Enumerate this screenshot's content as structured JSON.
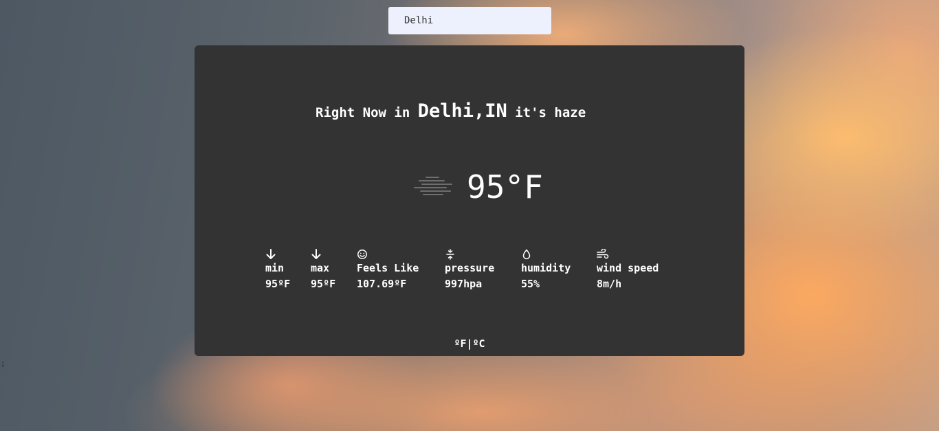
{
  "search": {
    "value": "Delhi"
  },
  "stray_text": ";",
  "weather": {
    "headline_prefix": "Right Now in ",
    "place": "Delhi,IN",
    "headline_suffix": " it's haze",
    "condition_icon": "haze-icon",
    "temperature": "95°F"
  },
  "stats": [
    {
      "icon": "arrow-down-icon",
      "label": "min",
      "value": "95ºF"
    },
    {
      "icon": "arrow-down-icon",
      "label": "max",
      "value": "95ºF"
    },
    {
      "icon": "smiley-icon",
      "label": "Feels Like",
      "value": "107.69ºF"
    },
    {
      "icon": "pressure-icon",
      "label": "pressure",
      "value": "997hpa"
    },
    {
      "icon": "droplet-icon",
      "label": "humidity",
      "value": "55%"
    },
    {
      "icon": "wind-icon",
      "label": "wind speed",
      "value": "8m/h"
    }
  ],
  "units_toggle": {
    "fahrenheit": "ºF",
    "separator": "|",
    "celsius": "ºC"
  },
  "colors": {
    "card_background": "#333333",
    "search_background": "#ecf1fd",
    "text": "#ffffff"
  }
}
